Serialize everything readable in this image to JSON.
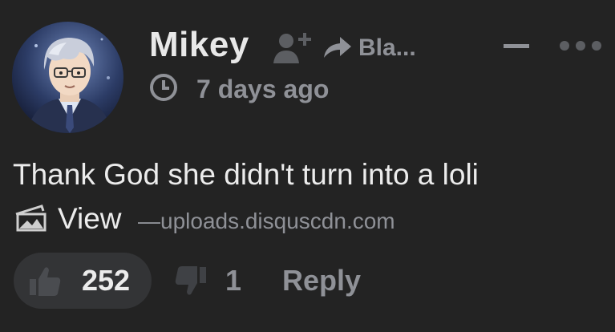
{
  "comment": {
    "author": "Mikey",
    "parent_author": "Bla...",
    "timestamp": "7 days ago",
    "body": "Thank God she didn't turn into a loli",
    "media": {
      "view_label": "View",
      "separator": "—",
      "domain": "uploads.disquscdn.com"
    },
    "votes": {
      "upvotes": "252",
      "downvotes": "1"
    },
    "reply_label": "Reply"
  },
  "icons": {
    "follow": "follow-user-icon",
    "reply_arrow": "reply-arrow-icon",
    "collapse": "collapse-icon",
    "more": "more-options-icon",
    "clock": "clock-icon",
    "media": "image-media-icon",
    "upvote": "thumbs-up-icon",
    "downvote": "thumbs-down-icon"
  },
  "colors": {
    "background": "#232323",
    "primary_text": "#ececec",
    "muted_text": "#8f9197",
    "pill": "#333436",
    "icon": "#5c5e62"
  }
}
